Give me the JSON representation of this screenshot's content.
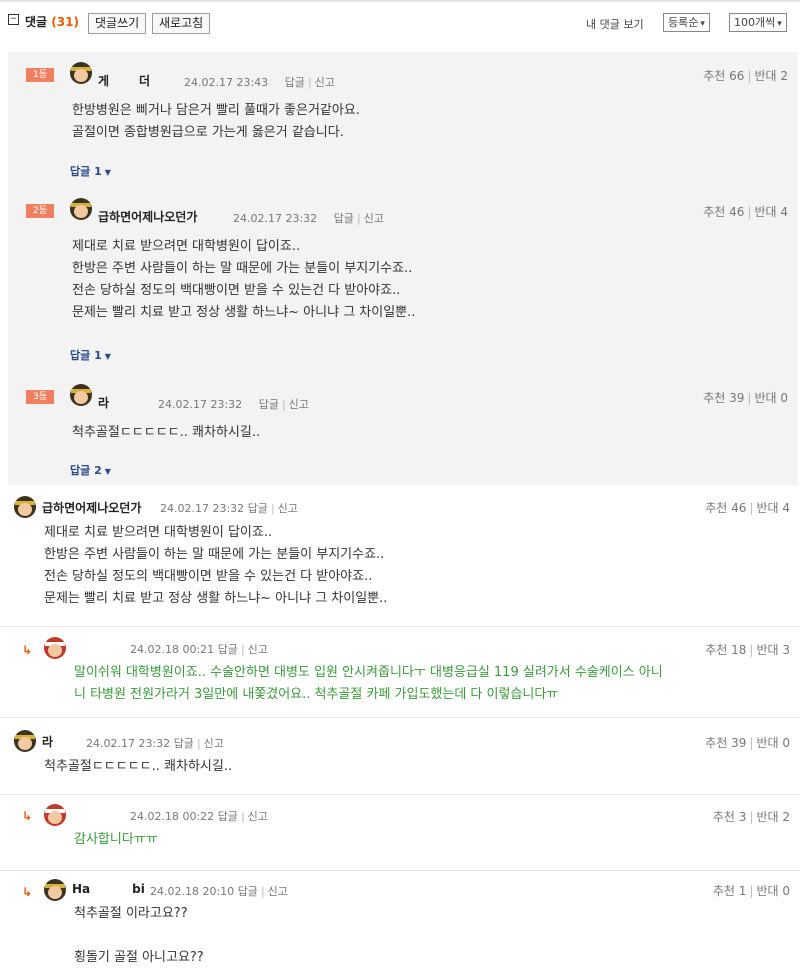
{
  "toolbar": {
    "toggle": "−",
    "title": "댓글",
    "count": "(31)",
    "write_button": "댓글쓰기",
    "refresh_button": "새로고침",
    "my_comments": "내 댓글 보기",
    "sort": "등록순",
    "page_size": "100개씩"
  },
  "best_comments": [
    {
      "rank": "1등",
      "nickname_start": "게",
      "nickname_end": "더",
      "date": "24.02.17 23:43",
      "reply_link": "답글",
      "report_link": "신고",
      "upvotes": "추천 66",
      "downvotes": "반대 2",
      "lines": [
        "한방병원은 삐거나 담은거 빨리 풀때가 좋은거같아요.",
        "골절이면 종합병원급으로 가는게 옳은거 같습니다."
      ],
      "replies": "답글 1"
    },
    {
      "rank": "2등",
      "nickname_start": "급하면어제나오던가",
      "nickname_end": "",
      "date": "24.02.17 23:32",
      "reply_link": "답글",
      "report_link": "신고",
      "upvotes": "추천 46",
      "downvotes": "반대 4",
      "lines": [
        "제대로 치료 받으려면 대학병원이 답이죠..",
        "한방은 주변 사람들이 하는 말 때문에 가는 분들이 부지기수죠..",
        "전손 당하실 정도의 백대빵이면 받을 수 있는건 다 받아야죠..",
        "문제는 빨리 치료 받고 정상 생활 하느냐~ 아니냐 그 차이일뿐.."
      ],
      "replies": "답글 1"
    },
    {
      "rank": "3등",
      "nickname_start": "라",
      "nickname_end": "",
      "date": "24.02.17 23:32",
      "reply_link": "답글",
      "report_link": "신고",
      "upvotes": "추천 39",
      "downvotes": "반대 0",
      "lines": [
        "척추골절ㄷㄷㄷㄷㄷ.. 쾌차하시길.."
      ],
      "replies": "답글 2"
    }
  ],
  "comments": [
    {
      "nickname_start": "급하면어제나오던가",
      "nickname_end": "",
      "date": "24.02.17 23:32",
      "reply_link": "답글",
      "report_link": "신고",
      "upvotes": "추천 46",
      "downvotes": "반대 4",
      "lines": [
        "제대로 치료 받으려면 대학병원이 답이죠..",
        "한방은 주변 사람들이 하는 말 때문에 가는 분들이 부지기수죠..",
        "전손 당하실 정도의 백대빵이면 받을 수 있는건 다 받아야죠..",
        "문제는 빨리 치료 받고 정상 생활 하느냐~ 아니냐 그 차이일뿐.."
      ]
    },
    {
      "nickname_start": "",
      "nickname_end": "",
      "date": "24.02.18 00:21",
      "reply_link": "답글",
      "report_link": "신고",
      "upvotes": "추천 18",
      "downvotes": "반대 3",
      "lines": [
        "말이쉬워 대학병원이죠.. 수술안하면 대병도 입원 안시켜줍니다ㅜ 대병응급실 119 실려가서 수술케이스 아니",
        "니 타병원 전원가라거 3일만에 내쫓겼어요.. 척추골절 카페 가입도했는데 다 이렇습니다ㅠ"
      ]
    },
    {
      "nickname_start": "라",
      "nickname_end": "",
      "date": "24.02.17 23:32",
      "reply_link": "답글",
      "report_link": "신고",
      "upvotes": "추천 39",
      "downvotes": "반대 0",
      "lines": [
        "척추골절ㄷㄷㄷㄷㄷ.. 쾌차하시길.."
      ]
    },
    {
      "nickname_start": "",
      "nickname_end": "",
      "date": "24.02.18 00:22",
      "reply_link": "답글",
      "report_link": "신고",
      "upvotes": "추천 3",
      "downvotes": "반대 2",
      "lines": [
        "감사합니다ㅠㅠ"
      ]
    },
    {
      "nickname_start": "Ha",
      "nickname_end": "bi",
      "date": "24.02.18 20:10",
      "reply_link": "답글",
      "report_link": "신고",
      "upvotes": "추천 1",
      "downvotes": "반대 0",
      "lines": [
        "척추골절 이라고요??",
        "",
        "횡돌기 골절 아니고요??"
      ]
    }
  ],
  "reply_arrow": "↳",
  "colors": {
    "accent": "#e85a00",
    "rank_badge": "#f08060",
    "reply_text": "#3a9a3a",
    "reply_link": "#2b4a8c"
  }
}
